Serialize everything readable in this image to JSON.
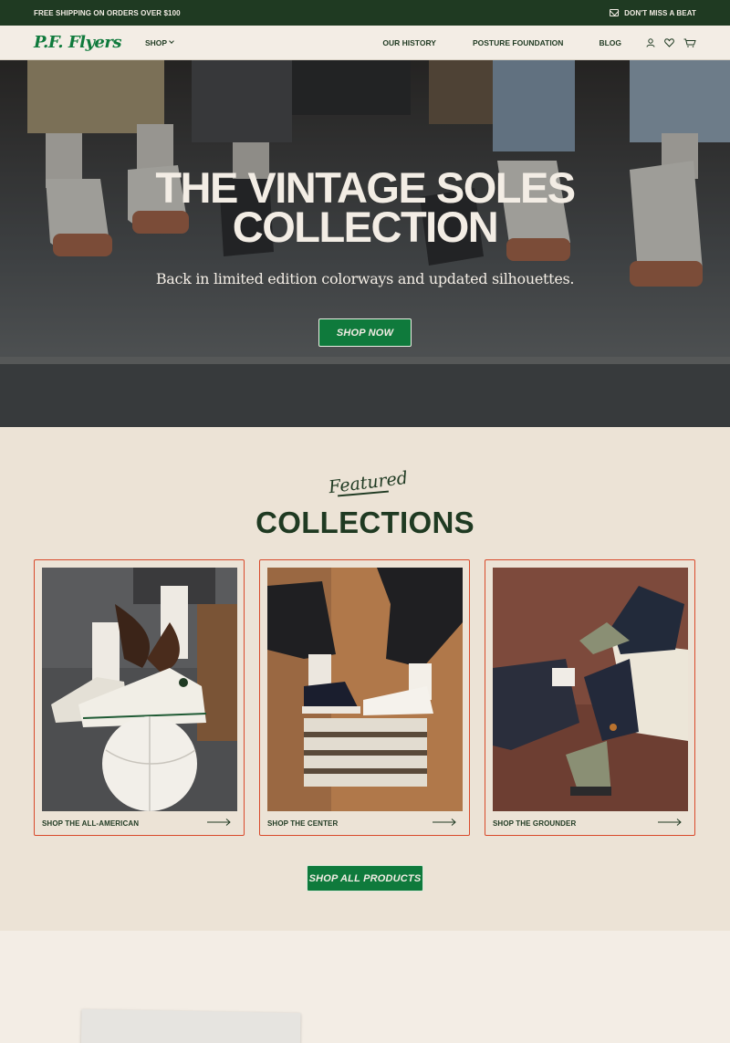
{
  "announcement": {
    "shipping_text": "FREE SHIPPING ON ORDERS OVER $100",
    "newsletter_text": "DON'T MISS A BEAT",
    "newsletter_icon": "mail-icon"
  },
  "nav": {
    "logo_text": "P.F. Flyers",
    "shop_label": "SHOP",
    "links": [
      "OUR HISTORY",
      "POSTURE FOUNDATION",
      "BLOG"
    ],
    "icons": [
      "account-icon",
      "heart-icon",
      "cart-icon"
    ]
  },
  "hero": {
    "title_line1": "THE VINTAGE SOLES",
    "title_line2": "COLLECTION",
    "subtitle": "Back in limited edition colorways and updated silhouettes.",
    "cta_label": "SHOP NOW"
  },
  "featured": {
    "script_label": "Featured",
    "title": "COLLECTIONS",
    "cards": [
      {
        "label": "SHOP THE ALL-AMERICAN"
      },
      {
        "label": "SHOP THE CENTER"
      },
      {
        "label": "SHOP THE GROUNDER"
      }
    ],
    "cta_label": "SHOP ALL PRODUCTS"
  },
  "colors": {
    "brand_green": "#0f7a3c",
    "dark_green": "#1f3a22",
    "cream": "#f3ede5",
    "card_border": "#d94a2b"
  }
}
